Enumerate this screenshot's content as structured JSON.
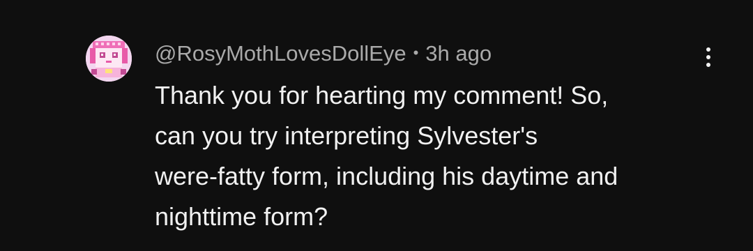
{
  "comment": {
    "author": "@RosyMothLovesDollEye",
    "separator": "•",
    "time": "3h ago",
    "text_lines": [
      "Thank you for hearting my comment! So,",
      "can you try interpreting Sylvester's",
      "were-fatty form, including his daytime and",
      "nighttime form?"
    ],
    "avatar_icon": "pixel-art-doll-avatar",
    "menu_icon": "more-vertical-icon"
  },
  "colors": {
    "background": "#0f0f0f",
    "text_primary": "#f1f1f1",
    "text_secondary": "#aaaaaa",
    "avatar_bg": "#f0d8ee",
    "avatar_accent": "#e85aa8"
  }
}
